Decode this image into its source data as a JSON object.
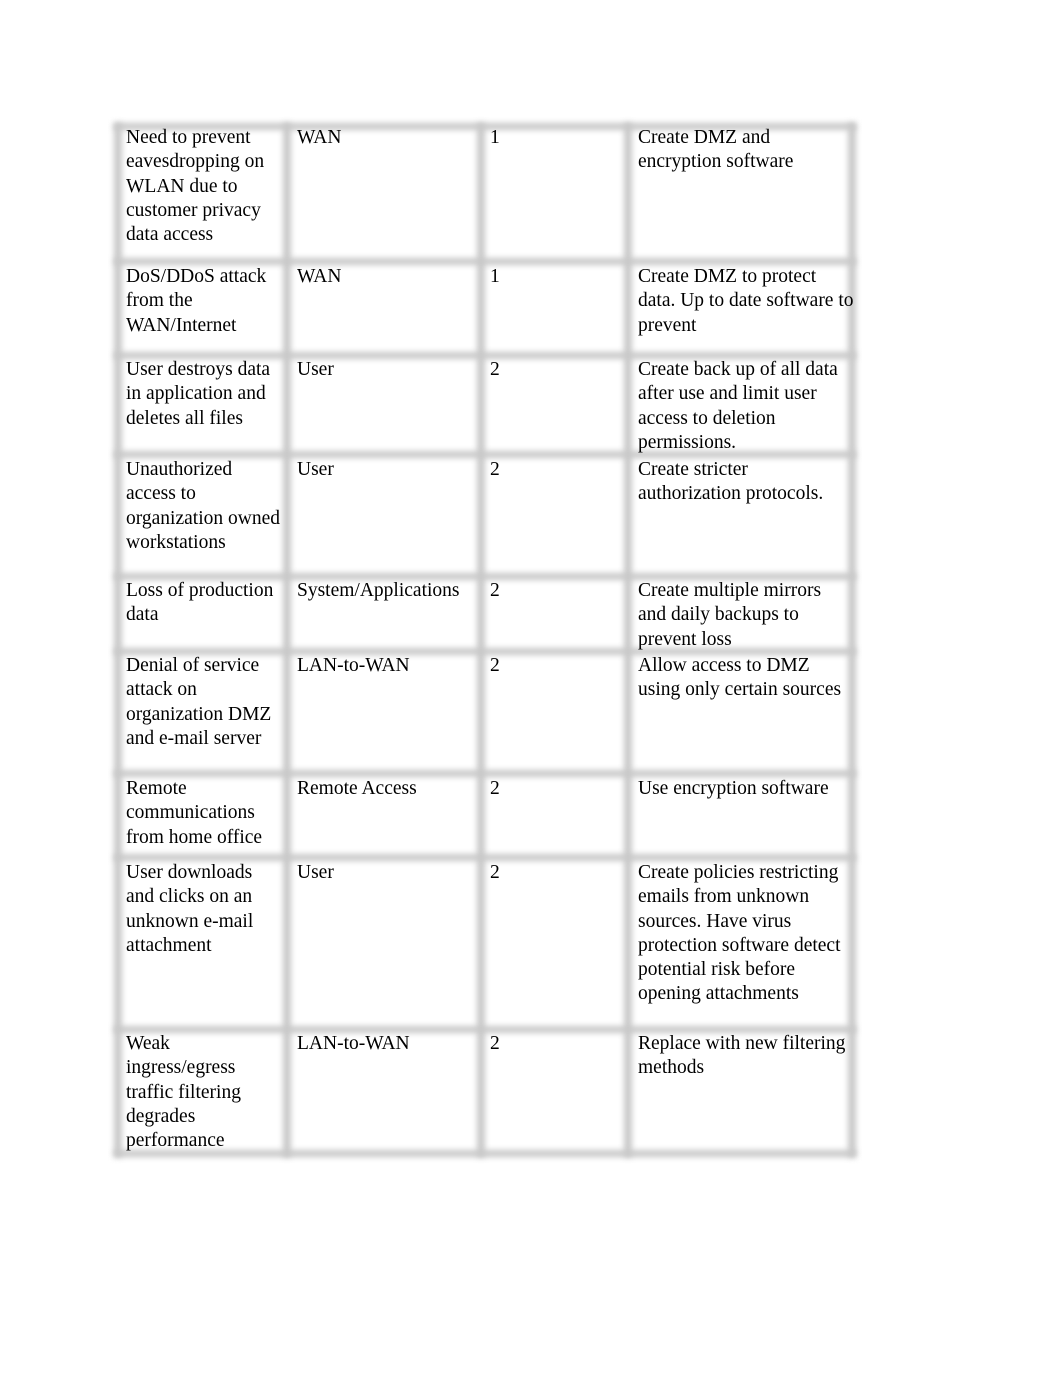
{
  "table": {
    "rows": [
      {
        "threat": "Need to prevent eavesdropping on WLAN due to customer privacy data access",
        "domain": "WAN",
        "priority": "1",
        "action": "Create DMZ and encryption software"
      },
      {
        "threat": "DoS/DDoS attack from the WAN/Internet",
        "domain": "WAN",
        "priority": "1",
        "action": "Create DMZ to protect data. Up to date software to prevent"
      },
      {
        "threat": "User destroys data in application and deletes all files",
        "domain": "User",
        "priority": "2",
        "action": "Create back up of all data after use and limit user access to deletion permissions."
      },
      {
        "threat": "Unauthorized access to organization owned workstations",
        "domain": "User",
        "priority": "2",
        "action": "Create stricter authorization protocols."
      },
      {
        "threat": "Loss of production data",
        "domain": "System/Applications",
        "priority": "2",
        "action": "Create multiple mirrors and  daily backups to prevent loss"
      },
      {
        "threat": "Denial of service attack on organization DMZ and e-mail server",
        "domain": "LAN-to-WAN",
        "priority": "2",
        "action": "Allow access to DMZ using only certain sources"
      },
      {
        "threat": "Remote communications from home office",
        "domain": "Remote Access",
        "priority": "2",
        "action": "Use encryption software"
      },
      {
        "threat": "User downloads and clicks on an unknown e-mail attachment",
        "domain": "User",
        "priority": "2",
        "action": "Create policies restricting emails from unknown sources. Have virus protection software detect potential risk before opening attachments"
      },
      {
        "threat": "Weak ingress/egress traffic filtering degrades performance",
        "domain": "LAN-to-WAN",
        "priority": "2",
        "action": "Replace with new filtering methods"
      }
    ]
  }
}
